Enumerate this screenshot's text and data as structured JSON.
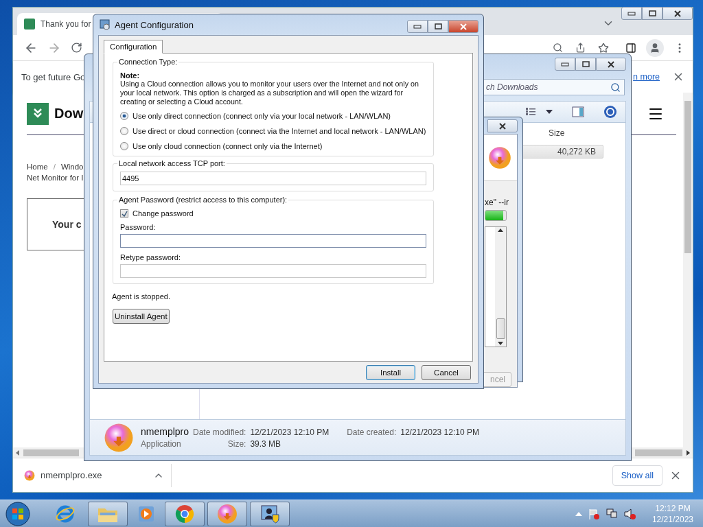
{
  "browser": {
    "tab_title": "Thank you for",
    "infobar": {
      "text": "To get future Go",
      "link": "n more"
    },
    "page": {
      "logo_text": "Dow",
      "breadcrumb": [
        "Home",
        "/",
        "Windo"
      ],
      "subtitle": "Net Monitor for I",
      "card_text": "Your c"
    },
    "downloads": {
      "file": "nmemplpro.exe",
      "show_all": "Show all"
    }
  },
  "explorer": {
    "search_placeholder": "ch Downloads",
    "columns": [
      "Size"
    ],
    "rows": [
      {
        "size": "40,272 KB",
        "selected": true
      }
    ],
    "details": {
      "name": "nmemplpro",
      "type": "Application",
      "fields": [
        {
          "label": "Date modified:",
          "value": "12/21/2023 12:10 PM"
        },
        {
          "label": "Date created:",
          "value": "12/21/2023 12:10 PM"
        },
        {
          "label": "Size:",
          "value": "39.3 MB"
        }
      ]
    }
  },
  "installer": {
    "command": "xe\" --ir",
    "progress": {
      "level": 0.85
    },
    "button": "ncel"
  },
  "dialog": {
    "title": "Agent Configuration",
    "tabs": [
      {
        "label": "Configuration",
        "selected": true
      }
    ],
    "connection": {
      "legend": "Connection Type:",
      "note_title": "Note:",
      "note": "Using a Cloud connection allows you to monitor your users over the Internet and not only on your local network. This option is charged as a subscription and will open the wizard for creating or selecting a Cloud account.",
      "options": [
        {
          "label": "Use only direct connection (connect only via your local network - LAN/WLAN)",
          "selected": true
        },
        {
          "label": "Use direct or cloud connection (connect via the Internet and local network - LAN/WLAN)",
          "selected": false
        },
        {
          "label": "Use only cloud connection (connect only via the Internet)",
          "selected": false
        }
      ]
    },
    "port": {
      "legend": "Local network access TCP port:",
      "value": "4495"
    },
    "password": {
      "legend": "Agent Password (restrict access to this computer):",
      "change": {
        "label": "Change password",
        "checked": true
      },
      "fields": [
        {
          "label": "Password:",
          "focused": true
        },
        {
          "label": "Retype password:",
          "focused": false
        }
      ]
    },
    "status": "Agent is stopped.",
    "uninstall": "Uninstall Agent",
    "buttons": [
      {
        "label": "Install",
        "default": true
      },
      {
        "label": "Cancel",
        "default": false
      }
    ]
  },
  "taskbar": {
    "items": [
      {
        "kind": "ie",
        "running": false
      },
      {
        "kind": "explorer",
        "running": true
      },
      {
        "kind": "media",
        "running": false
      },
      {
        "kind": "chrome",
        "running": true
      },
      {
        "kind": "installer",
        "running": true
      },
      {
        "kind": "agent",
        "running": true
      }
    ],
    "clock": {
      "time": "12:12 PM",
      "date": "12/21/2023"
    }
  }
}
